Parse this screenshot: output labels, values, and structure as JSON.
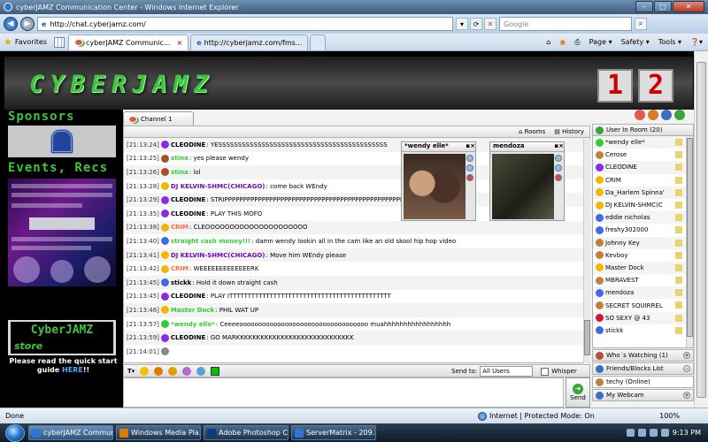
{
  "window": {
    "title": "cyberJAMZ Communication Center - Windows Internet Explorer",
    "min": "–",
    "max": "□",
    "close": "✕"
  },
  "addressbar": {
    "url": "http://chat.cyberjamz.com/",
    "search_placeholder": "Google"
  },
  "tabsbar": {
    "favorites": "Favorites",
    "tabs": [
      {
        "label": "cyberJAMZ Communic..."
      },
      {
        "label": "http://cyberjamz.com/fms..."
      }
    ],
    "tools": [
      "Page ▾",
      "Safety ▾",
      "Tools ▾",
      "❓▾"
    ]
  },
  "banner": {
    "logo": "CYBERJAMZ",
    "num1": "1",
    "num2": "2"
  },
  "left": {
    "sponsors_title": "Sponsors",
    "events_title": "Events, Recs",
    "store_top": "CyberJAMZ",
    "store_bottom": "store",
    "quickstart_text": "Please read the quick start guide",
    "quickstart_link": "HERE",
    "quickstart_suffix": "!!"
  },
  "chat": {
    "channel_tab": "Channel 1",
    "rooms": "Rooms",
    "history": "History",
    "messages": [
      {
        "time": "[21:13:24]",
        "user": "CLEODINE",
        "color": "#000000",
        "icon": "#8a2be2",
        "text": ": YESSSSSSSSSSSSSSSSSSSSSSSSSSSSSSSSSSSSSSSSSSS"
      },
      {
        "time": "[21:13:25]",
        "user": "xtina",
        "color": "#32cd32",
        "icon": "#a0522d",
        "text": ": yes please wendy"
      },
      {
        "time": "[21:13:26]",
        "user": "xtina",
        "color": "#32cd32",
        "icon": "#a0522d",
        "text": ": lol"
      },
      {
        "time": "[21:13:28]",
        "user": "DJ KELVIN-SHMC(CHICAGO)",
        "color": "#6a0dad",
        "icon": "#f2b700",
        "text": ": come back WEndy"
      },
      {
        "time": "[21:13:29]",
        "user": "CLEODINE",
        "color": "#000000",
        "icon": "#8a2be2",
        "text": ": STRIPPPPPPPPPPPPPPPPPPPPPPPPPPPPPPPPPPPPPPPPPPPPPPPPPPPP"
      },
      {
        "time": "[21:13:35]",
        "user": "CLEODINE",
        "color": "#000000",
        "icon": "#8a2be2",
        "text": ": PLAY THIS MOFO"
      },
      {
        "time": "[21:13:38]",
        "user": "CRIM",
        "color": "#ff6a3d",
        "icon": "#f2b700",
        "text": ": CLEOOOOOOOOOOOOOOOOOOOOO"
      },
      {
        "time": "[21:13:40]",
        "user": "straight cash money!!!",
        "color": "#32cd32",
        "icon": "#4169e1",
        "text": ": damn wendy lookin all in the cam like an old skool hip hop video"
      },
      {
        "time": "[21:13:41]",
        "user": "DJ KELVIN-SHMC(CHICAGO)",
        "color": "#6a0dad",
        "icon": "#f2b700",
        "text": ": Move him WEndy please"
      },
      {
        "time": "[21:13:42]",
        "user": "CRIM",
        "color": "#ff6a3d",
        "icon": "#f2b700",
        "text": ": WEEEEEEEEEEEEERK"
      },
      {
        "time": "[21:13:45]",
        "user": "stickk",
        "color": "#000000",
        "icon": "#4169e1",
        "text": ": Hold it down straight cash"
      },
      {
        "time": "[21:13:45]",
        "user": "CLEODINE",
        "color": "#000000",
        "icon": "#8a2be2",
        "text": ": PLAY ITTTTTTTTTTTTTTTTTTTTTTTTTTTTTTTTTTTTTTTTTTTT"
      },
      {
        "time": "[21:13:46]",
        "user": "Master Dock",
        "color": "#32cd32",
        "icon": "#f2b700",
        "text": ": PHIL WAT UP"
      },
      {
        "time": "[21:13:57]",
        "user": "*wendy elle*",
        "color": "#32cd32",
        "icon": "#32cd32",
        "text": ": Ceeeeoooooooooooooooooooooooooooooooooo muahhhhhhhhhhhhhhhhh"
      },
      {
        "time": "[21:13:59]",
        "user": "CLEODINE",
        "color": "#000000",
        "icon": "#8a2be2",
        "text": ": GO MARKKKKKKKKKKKKKKKKKKKKKKKKKKKKK"
      },
      {
        "time": "[21:14:01]",
        "user": "",
        "color": "#000000",
        "icon": "#888888",
        "text": ""
      }
    ],
    "cams": [
      {
        "name": "*wendy elle*"
      },
      {
        "name": "mendoza"
      }
    ],
    "send_to_label": "Send to:",
    "send_to_value": "All Users",
    "whisper_label": "Whisper",
    "send_label": "Send"
  },
  "users": {
    "header": "User In Room (20)",
    "list": [
      {
        "name": "*wendy elle*",
        "icon": "#32cd32"
      },
      {
        "name": "Cerose",
        "icon": "#c08040"
      },
      {
        "name": "CLEODINE",
        "icon": "#8a2be2"
      },
      {
        "name": "CRIM",
        "icon": "#f2b700"
      },
      {
        "name": "Da_Harlem Spinna'",
        "icon": "#f2b700"
      },
      {
        "name": "DJ KELVIN-SHMC(C",
        "icon": "#f2b700"
      },
      {
        "name": "eddie nicholas",
        "icon": "#4169e1"
      },
      {
        "name": "freshy302000",
        "icon": "#4169e1"
      },
      {
        "name": "Johnny Key",
        "icon": "#c08040"
      },
      {
        "name": "Kevboy",
        "icon": "#c08040"
      },
      {
        "name": "Master Dock",
        "icon": "#f2b700"
      },
      {
        "name": "MBRAVEST",
        "icon": "#c08040"
      },
      {
        "name": "mendoza",
        "icon": "#4169e1"
      },
      {
        "name": "SECRET SQUIRREL",
        "icon": "#c08040"
      },
      {
        "name": "SO SEXY @ 43",
        "icon": "#d2143a"
      },
      {
        "name": "stickk",
        "icon": "#4169e1"
      }
    ],
    "whos_watching": "Who´s Watching (1)",
    "friends": "Friends/Blocks List",
    "friend_online": "techy (Online)",
    "my_webcam": "My Webcam"
  },
  "statusbar": {
    "status": "Done",
    "zone": "Internet | Protected Mode: On",
    "zoom": "100%"
  },
  "taskbar": {
    "tasks": [
      "cyberJAMZ Commun...",
      "Windows Media Pla...",
      "Adobe Photoshop C...",
      "ServerMatrix - 209.8..."
    ],
    "clock": "9:13 PM"
  }
}
